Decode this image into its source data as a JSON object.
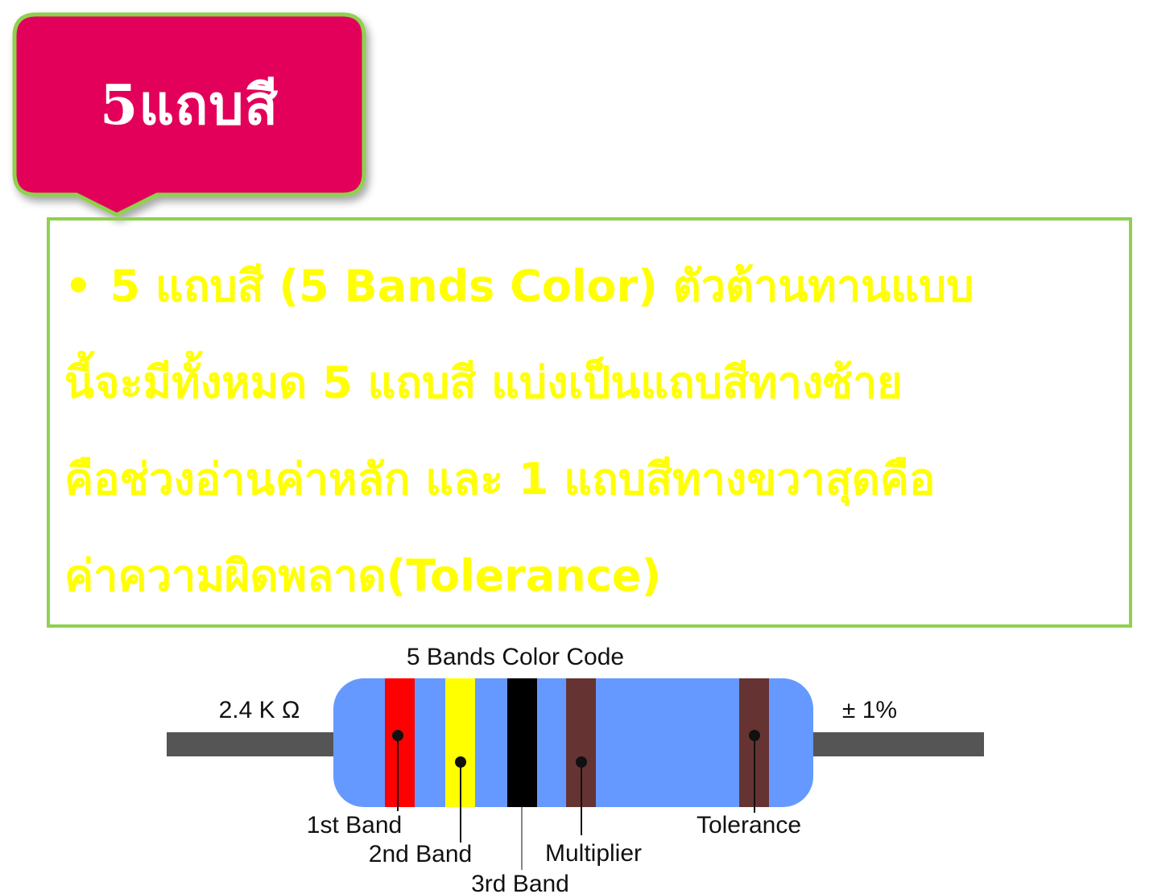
{
  "callout": {
    "title": "5แถบสี",
    "fill_color": "#e3005a",
    "border_color": "#8fd14f"
  },
  "description": {
    "bullet": "•",
    "lines": [
      "5 แถบสี (5 Bands Color) ตัวต้านทานแบบ",
      "นี้จะมีทั้งหมด 5 แถบสี แบ่งเป็นแถบสีทางซ้าย",
      "คือช่วงอ่านค่าหลัก และ 1 แถบสีทางขวาสุดคือ",
      "ค่าความผิดพลาด(Tolerance)"
    ],
    "text_color": "#ffff00",
    "border_color": "#8fd14f"
  },
  "diagram": {
    "title": "5 Bands Color Code",
    "resistance_label": "2.4 K Ω",
    "tolerance_value": "± 1%",
    "body_color": "#6699ff",
    "lead_color": "#555555",
    "bands": [
      {
        "name": "1st Band",
        "color": "#ff0000"
      },
      {
        "name": "2nd Band",
        "color": "#ffff00"
      },
      {
        "name": "3rd Band",
        "color": "#000000"
      },
      {
        "name": "Multiplier",
        "color": "#663333"
      },
      {
        "name": "Tolerance",
        "color": "#663333"
      }
    ]
  }
}
